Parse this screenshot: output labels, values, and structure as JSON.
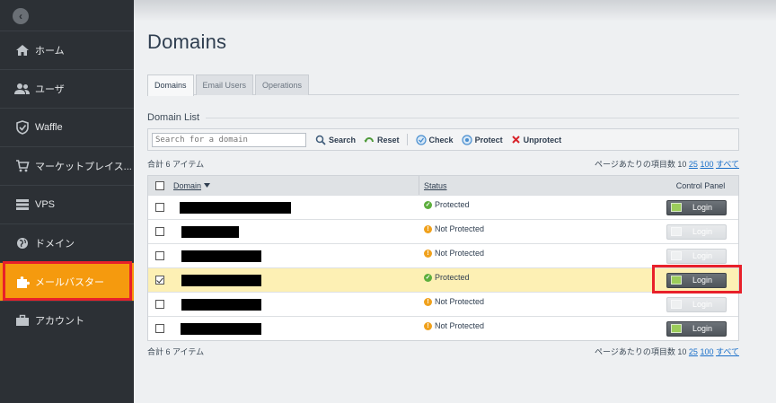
{
  "sidebar": {
    "collapse_glyph": "‹",
    "items": [
      {
        "label": "ホーム",
        "icon": "home-icon"
      },
      {
        "label": "ユーザ",
        "icon": "users-icon"
      },
      {
        "label": "Waffle",
        "icon": "shield-icon"
      },
      {
        "label": "マーケットプレイス...",
        "icon": "cart-icon"
      },
      {
        "label": "VPS",
        "icon": "server-icon"
      },
      {
        "label": "ドメイン",
        "icon": "globe-icon"
      },
      {
        "label": "メールバスター",
        "icon": "puzzle-icon",
        "active": true
      },
      {
        "label": "アカウント",
        "icon": "briefcase-icon"
      }
    ],
    "active_color": "#f59a0e"
  },
  "page": {
    "title": "Domains"
  },
  "tabs": [
    {
      "label": "Domains",
      "active": true
    },
    {
      "label": "Email Users",
      "active": false
    },
    {
      "label": "Operations",
      "active": false
    }
  ],
  "domain_list": {
    "title": "Domain List",
    "search_placeholder": "Search for a domain",
    "toolbar": {
      "search_label": "Search",
      "reset_label": "Reset",
      "check_label": "Check",
      "protect_label": "Protect",
      "unprotect_label": "Unprotect"
    },
    "count_text": "合計 6 アイテム",
    "perpage_prefix": "ページあたりの項目数",
    "perpage_options": [
      "10",
      "25",
      "100",
      "すべて"
    ],
    "columns": {
      "domain": "Domain",
      "status": "Status",
      "control_panel": "Control Panel"
    },
    "login_label": "Login",
    "rows": [
      {
        "status": "Protected",
        "status_type": "ok",
        "selected": false,
        "login_enabled": true
      },
      {
        "status": "Not Protected",
        "status_type": "warn",
        "selected": false,
        "login_enabled": false
      },
      {
        "status": "Not Protected",
        "status_type": "warn",
        "selected": false,
        "login_enabled": false
      },
      {
        "status": "Protected",
        "status_type": "ok",
        "selected": true,
        "login_enabled": true
      },
      {
        "status": "Not Protected",
        "status_type": "warn",
        "selected": false,
        "login_enabled": false
      },
      {
        "status": "Not Protected",
        "status_type": "warn",
        "selected": false,
        "login_enabled": true
      }
    ]
  },
  "colors": {
    "highlight_red": "#e8202a",
    "protected_green": "#5cae3c",
    "warning_orange": "#f0a11c",
    "link_blue": "#1a6fc9"
  }
}
